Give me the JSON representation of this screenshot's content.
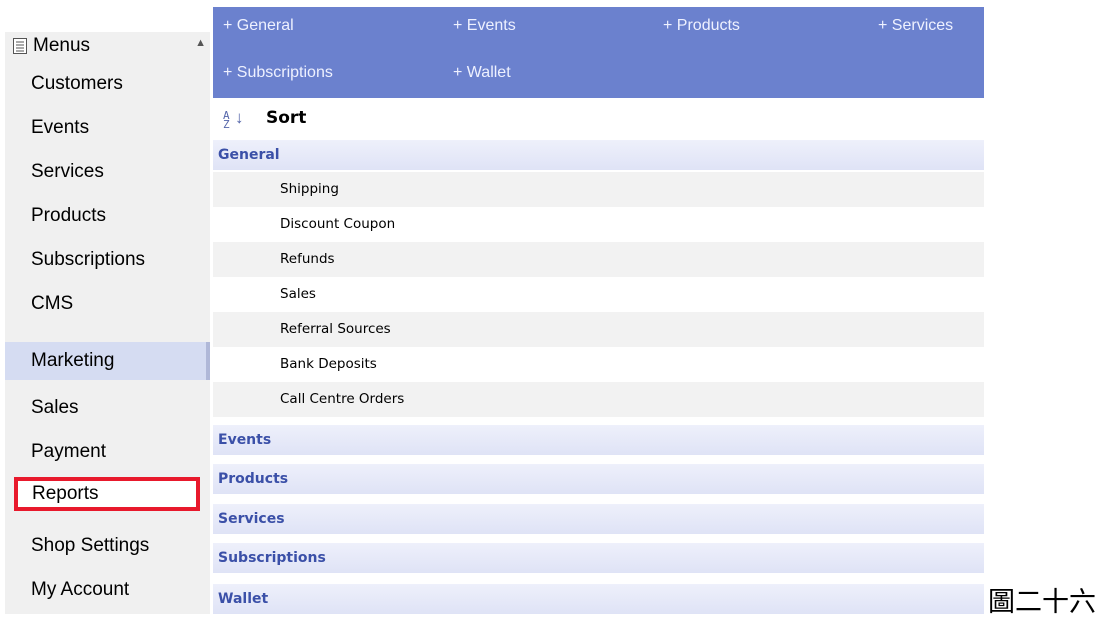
{
  "sidebar": {
    "header": {
      "title": "Menus",
      "icon": "menu-list-icon",
      "collapse_icon": "collapse-up-icon"
    },
    "items": [
      {
        "label": "Customers"
      },
      {
        "label": "Events"
      },
      {
        "label": "Services"
      },
      {
        "label": "Products"
      },
      {
        "label": "Subscriptions"
      },
      {
        "label": "CMS"
      },
      {
        "label": "Marketing",
        "state": "hover"
      },
      {
        "label": "Sales"
      },
      {
        "label": "Payment"
      },
      {
        "label": "Reports",
        "state": "highlighted",
        "highlight_color": "#e8192c"
      },
      {
        "label": "Shop Settings"
      },
      {
        "label": "My Account"
      }
    ]
  },
  "topnav": {
    "color": "#6b81ce",
    "links": [
      {
        "label": "+ General"
      },
      {
        "label": "+ Events"
      },
      {
        "label": "+ Products"
      },
      {
        "label": "+ Services"
      },
      {
        "label": "+ Subscriptions"
      },
      {
        "label": "+ Wallet"
      }
    ]
  },
  "reports": {
    "sort_label": "Sort",
    "sort_icon": "sort-ascending-icon",
    "categories": [
      {
        "label": "General",
        "items": [
          "Shipping",
          "Discount Coupon",
          "Refunds",
          "Sales",
          "Referral Sources",
          "Bank Deposits",
          "Call Centre Orders"
        ]
      },
      {
        "label": "Events",
        "items": []
      },
      {
        "label": "Products",
        "items": []
      },
      {
        "label": "Services",
        "items": []
      },
      {
        "label": "Subscriptions",
        "items": []
      },
      {
        "label": "Wallet",
        "items": []
      }
    ]
  },
  "caption": "圖二十六"
}
